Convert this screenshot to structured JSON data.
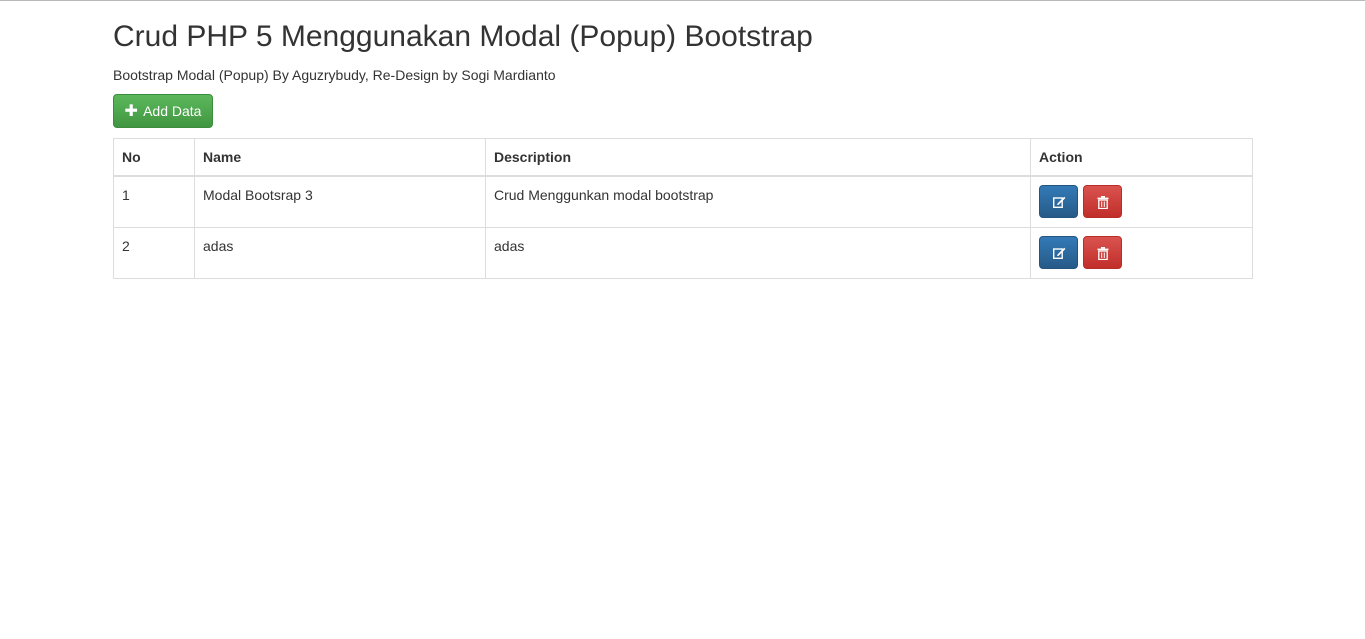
{
  "page": {
    "title": "Crud PHP 5 Menggunakan Modal (Popup) Bootstrap",
    "subtitle": "Bootstrap Modal (Popup) By Aguzrybudy, Re-Design by Sogi Mardianto"
  },
  "toolbar": {
    "add_icon": "plus-icon",
    "add_label": "Add Data"
  },
  "table": {
    "headers": {
      "no": "No",
      "name": "Name",
      "description": "Description",
      "action": "Action"
    },
    "rows": [
      {
        "no": "1",
        "name": "Modal Bootsrap 3",
        "description": "Crud Menggunkan modal bootstrap"
      },
      {
        "no": "2",
        "name": "adas",
        "description": "adas"
      }
    ],
    "action_icons": {
      "edit": "edit-icon",
      "delete": "trash-icon"
    }
  },
  "colors": {
    "success": "#5cb85c",
    "primary": "#337ab7",
    "danger": "#d9534f",
    "border": "#dddddd",
    "text": "#333333"
  }
}
